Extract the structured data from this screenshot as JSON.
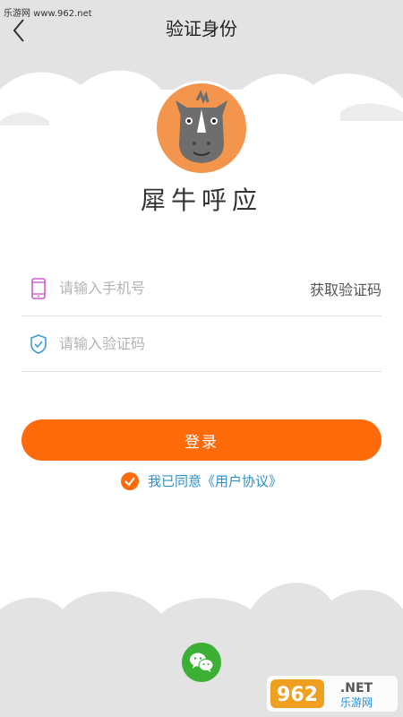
{
  "header": {
    "title": "验证身份",
    "watermark": "乐游网 www.962.net"
  },
  "brand": {
    "name": "犀牛呼应"
  },
  "form": {
    "phone_placeholder": "请输入手机号",
    "get_code_label": "获取验证码",
    "code_placeholder": "请输入验证码",
    "login_label": "登录",
    "agree_label": "我已同意《用户协议》"
  },
  "footer": {
    "wechat_icon": "wechat-icon",
    "watermark_number": "962",
    "watermark_suffix": ".NET",
    "watermark_text": "乐游网"
  },
  "colors": {
    "accent": "#ff6a0b",
    "link": "#2e8fc8",
    "wechat": "#3cb034",
    "avatar_bg": "#f3954c"
  }
}
